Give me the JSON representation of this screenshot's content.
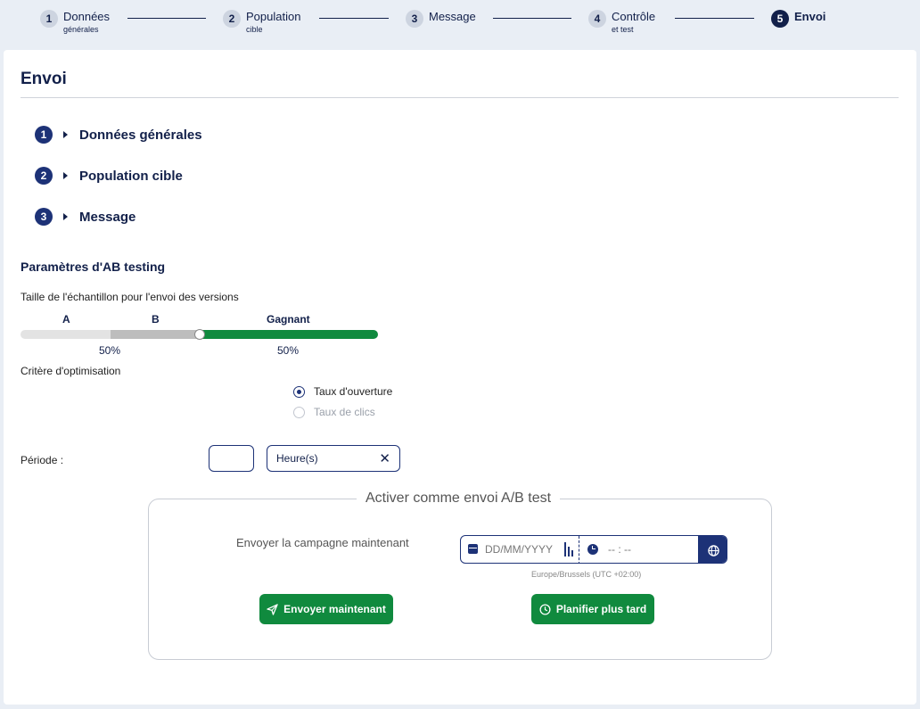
{
  "stepper": {
    "steps": [
      {
        "num": "1",
        "label": "Données",
        "sub": "générales"
      },
      {
        "num": "2",
        "label": "Population",
        "sub": "cible"
      },
      {
        "num": "3",
        "label": "Message",
        "sub": ""
      },
      {
        "num": "4",
        "label": "Contrôle",
        "sub": "et test"
      },
      {
        "num": "5",
        "label": "Envoi",
        "sub": ""
      }
    ],
    "active_step": 5
  },
  "page": {
    "title": "Envoi"
  },
  "accordion": [
    {
      "num": "1",
      "label": "Données générales"
    },
    {
      "num": "2",
      "label": "Population cible"
    },
    {
      "num": "3",
      "label": "Message"
    }
  ],
  "ab_params": {
    "title": "Paramètres d'AB testing",
    "sample_label": "Taille de l'échantillon pour l'envoi des versions",
    "slider": {
      "label_a": "A",
      "label_b": "B",
      "label_winner": "Gagnant",
      "pct_ab_text": "50%",
      "pct_winner_text": "50%",
      "test_fraction": 0.5,
      "winner_fraction": 0.5
    },
    "optimization_label": "Critère d'optimisation",
    "options": [
      {
        "label": "Taux d'ouverture",
        "checked": true
      },
      {
        "label": "Taux de clics",
        "checked": false
      }
    ],
    "period_label": "Période :",
    "period_value": "",
    "period_unit": "Heure(s)",
    "clear_symbol": "✕"
  },
  "activation": {
    "legend": "Activer comme envoi A/B test",
    "send_now_label": "Envoyer la campagne maintenant",
    "date_placeholder": "DD/MM/YYYY",
    "time_placeholder": "-- : --",
    "timezone": "Europe/Brussels (UTC +02:00)",
    "send_button": "Envoyer maintenant",
    "schedule_button": "Planifier plus tard"
  },
  "colors": {
    "primary": "#1d3277",
    "dark_navy": "#12204a",
    "success": "#108a3e",
    "page_bg": "#e9eef5"
  },
  "icons": [
    "calendar-icon",
    "clock-icon",
    "globe-icon",
    "send-icon",
    "schedule-clock-icon",
    "close-icon",
    "caret-right-icon"
  ]
}
